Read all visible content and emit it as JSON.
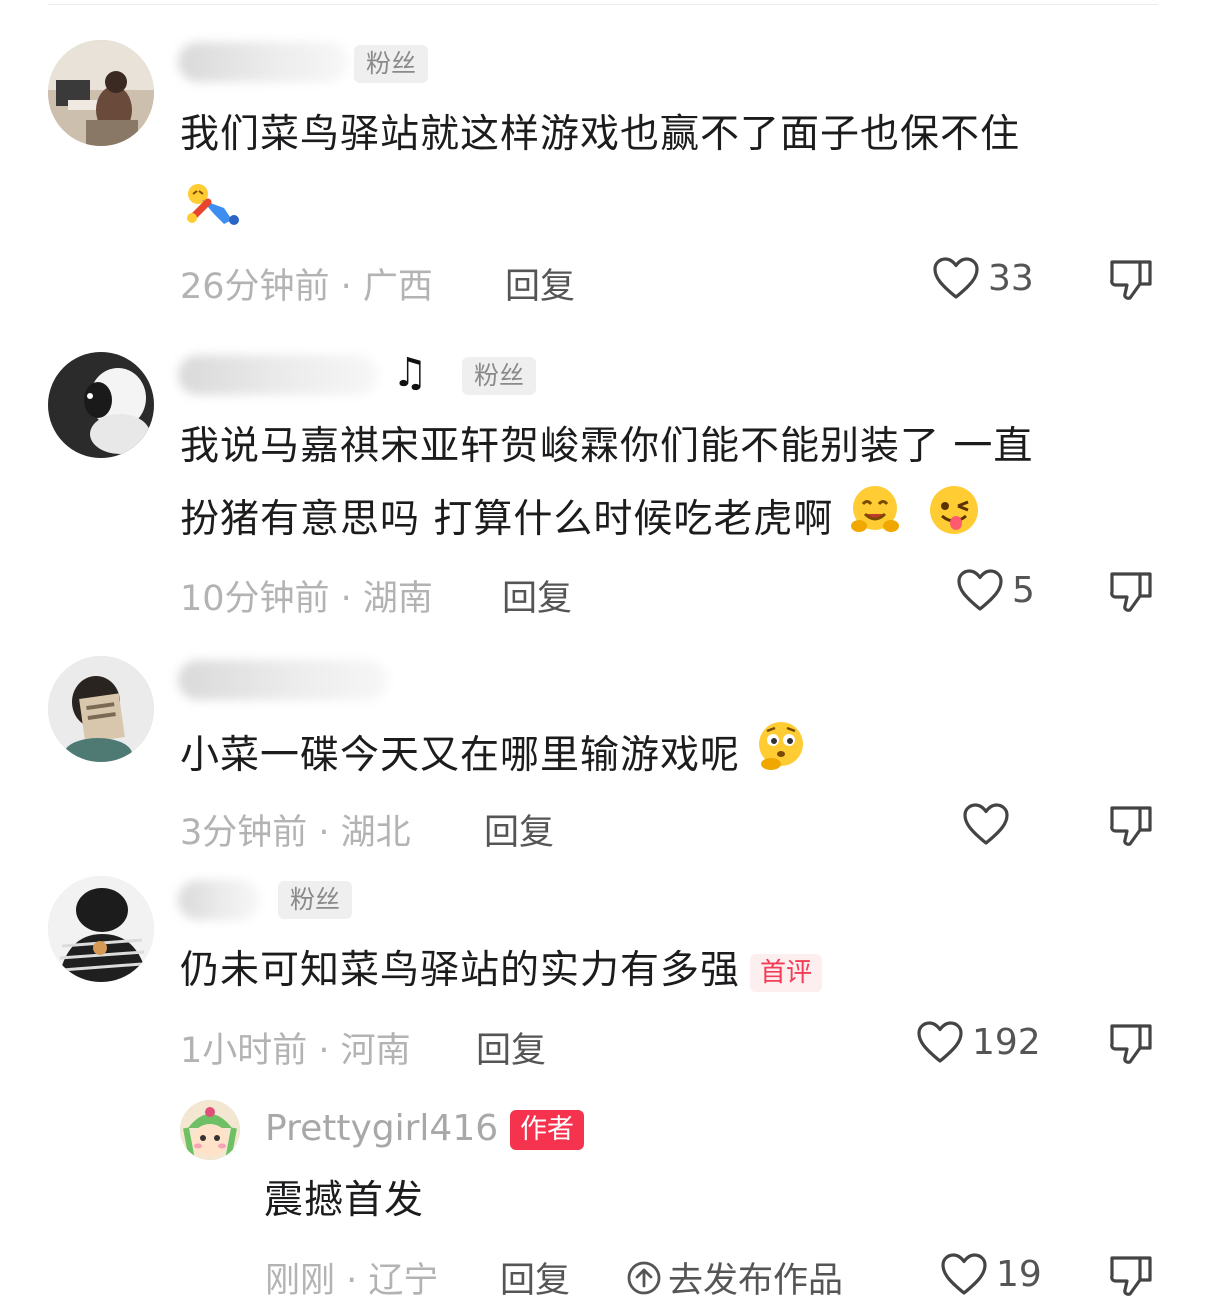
{
  "labels": {
    "fan": "粉丝",
    "reply": "回复",
    "first_comment": "首评",
    "author": "作者",
    "publish": "去发布作品"
  },
  "comments": [
    {
      "text": "我们菜鸟驿站就这样游戏也赢不了面子也保不住",
      "time": "26分钟前 · 广西",
      "likes": "33",
      "emoji": [
        "dizzy-person-emoji"
      ]
    },
    {
      "text_line1": "我说马嘉祺宋亚轩贺峻霖你们能不能别装了 一直",
      "text_line2": "扮猪有意思吗 打算什么时候吃老虎啊",
      "time": "10分钟前 · 湖南",
      "likes": "5",
      "emoji": [
        "smiling-hug-emoji",
        "winking-tongue-emoji"
      ]
    },
    {
      "text": "小菜一碟今天又在哪里输游戏呢",
      "time": "3分钟前 · 湖北",
      "likes": "",
      "emoji": [
        "thinking-emoji"
      ]
    },
    {
      "text": "仍未可知菜鸟驿站的实力有多强",
      "time": "1小时前 · 河南",
      "likes": "192",
      "reply": {
        "author": "Prettygirl416",
        "text": "震撼首发",
        "time": "刚刚 · 辽宁",
        "likes": "19"
      }
    }
  ],
  "colors": {
    "accent": "#f5334e",
    "meta": "#b3b3b3",
    "badge_bg": "#efefef"
  }
}
